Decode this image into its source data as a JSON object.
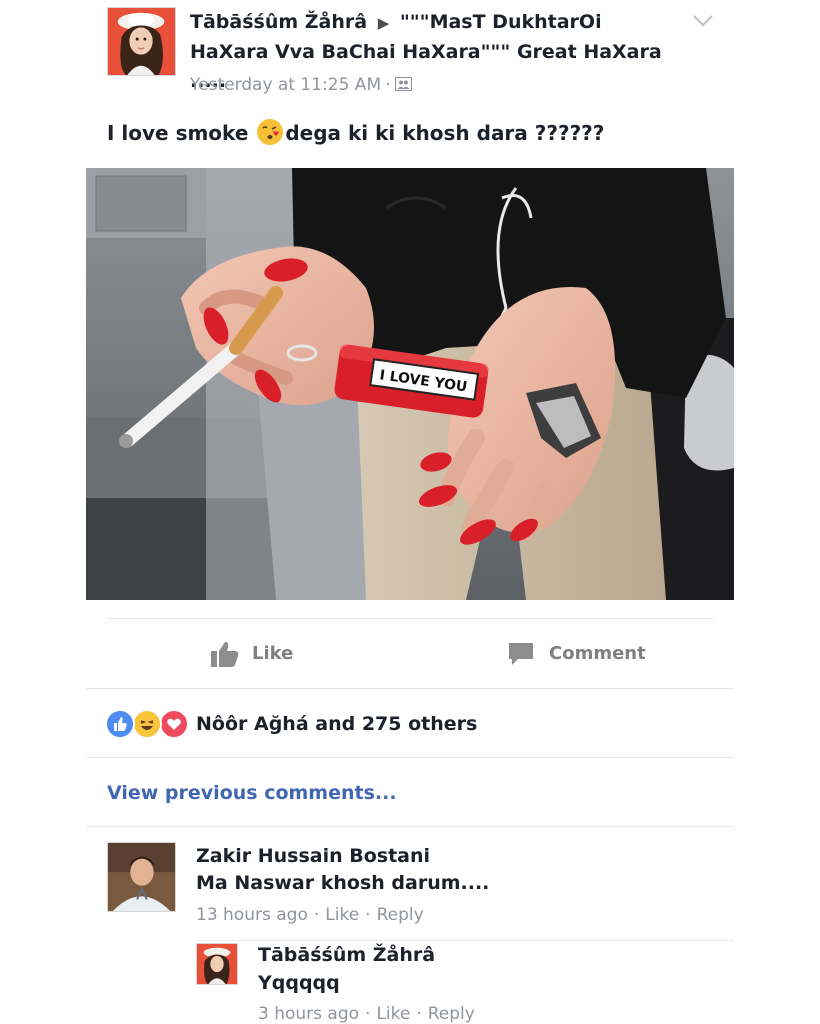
{
  "post": {
    "author": "Tābāśśûm Žåhrâ",
    "target": "\"\"\"MasT DukhtarOi HaXara Vva BaChai HaXara\"\"\" Great HaXara .....",
    "timestamp": "Yesterday at 11:25 AM",
    "audience_icon": "friends-icon",
    "text_before_emoji": "I love smoke ",
    "text_after_emoji": "dega ki ki khosh dara ??????",
    "photo_caption": "I LOVE YOU"
  },
  "actions": {
    "like_label": "Like",
    "comment_label": "Comment"
  },
  "reactions": {
    "icons": [
      "like-reaction",
      "haha-reaction",
      "love-reaction"
    ],
    "summary": "Nôôr Ağhá and 275 others"
  },
  "comments_section": {
    "view_previous": "View previous comments...",
    "comments": [
      {
        "name": "Zakir Hussain Bostani",
        "text": "Ma Naswar khosh darum....",
        "time": "13 hours ago",
        "like": "Like",
        "reply": "Reply"
      }
    ],
    "reply": {
      "name": "Tābāśśûm Žåhrâ",
      "text": "Yqqqqq",
      "time": "3 hours ago",
      "like": "Like",
      "reply": "Reply"
    }
  },
  "colors": {
    "link_blue": "#4267b2",
    "meta_gray": "#90949c",
    "text_dark": "#1d2129",
    "nail_red": "#d9202a"
  }
}
